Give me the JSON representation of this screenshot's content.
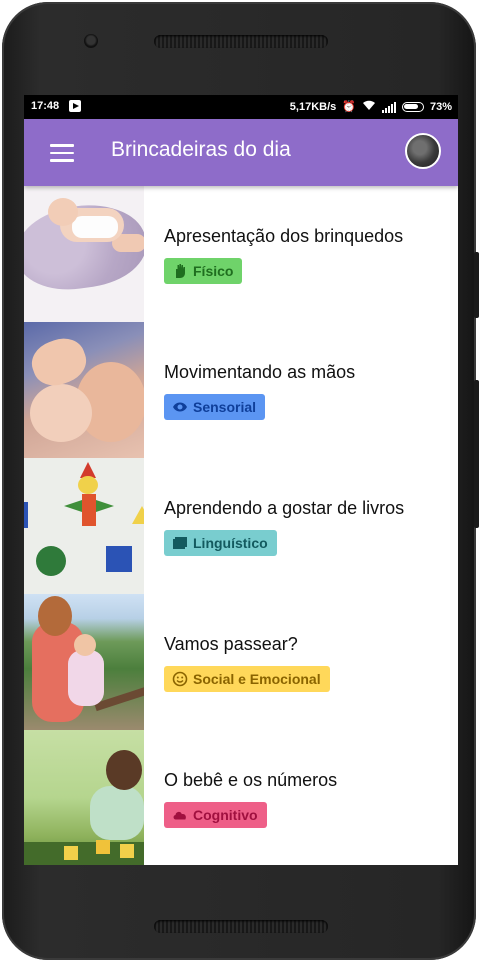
{
  "status_bar": {
    "time": "17:48",
    "network_speed": "5,17KB/s",
    "battery_percent": "73%",
    "icons": [
      "play-store-notification-icon",
      "alarm-icon",
      "wifi-icon",
      "signal-icon",
      "battery-icon"
    ]
  },
  "app_bar": {
    "title": "Brincadeiras do dia",
    "menu_icon": "hamburger-menu-icon",
    "avatar": "user-avatar",
    "color": "#8e6cc9"
  },
  "activities": [
    {
      "title": "Apresentação dos brinquedos",
      "badge": {
        "label": "Físico",
        "icon": "hand-icon",
        "bg": "#6fd36a",
        "fg": "#1f6e1f"
      }
    },
    {
      "title": "Movimentando as mãos",
      "badge": {
        "label": "Sensorial",
        "icon": "eye-icon",
        "bg": "#5b95f2",
        "fg": "#0f3f9a"
      }
    },
    {
      "title": "Aprendendo a gostar de livros",
      "badge": {
        "label": "Linguístico",
        "icon": "book-icon",
        "bg": "#79cdcf",
        "fg": "#135a5f"
      }
    },
    {
      "title": "Vamos passear?",
      "badge": {
        "label": "Social e Emocional",
        "icon": "smiley-icon",
        "bg": "#ffd85a",
        "fg": "#8a6400"
      }
    },
    {
      "title": "O bebê e os números",
      "badge": {
        "label": "Cognitivo",
        "icon": "cloud-icon",
        "bg": "#ee5f88",
        "fg": "#a0103f"
      }
    }
  ]
}
